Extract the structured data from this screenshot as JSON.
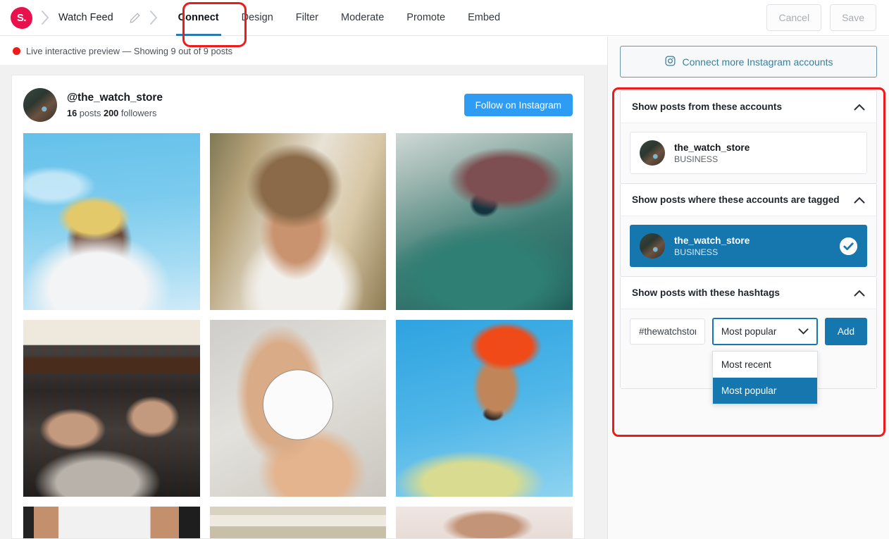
{
  "topbar": {
    "logo_text": "S.",
    "breadcrumb": "Watch Feed",
    "pencil_icon": "pencil-icon",
    "tabs": [
      {
        "label": "Connect",
        "active": true
      },
      {
        "label": "Design",
        "active": false
      },
      {
        "label": "Filter",
        "active": false
      },
      {
        "label": "Moderate",
        "active": false
      },
      {
        "label": "Promote",
        "active": false
      },
      {
        "label": "Embed",
        "active": false
      }
    ],
    "cancel_label": "Cancel",
    "save_label": "Save"
  },
  "status": {
    "text": "Live interactive preview — Showing 9 out of 9 posts",
    "dot_color": "#ee1b1b"
  },
  "preview": {
    "handle": "@the_watch_store",
    "posts_count": "16",
    "posts_word": "posts",
    "followers_count": "200",
    "followers_word": "followers",
    "follow_button": "Follow on Instagram"
  },
  "sidebar": {
    "connect_more_label": "Connect more Instagram accounts",
    "connect_more_icon": "instagram-icon",
    "panels": [
      {
        "title": "Show posts from these accounts",
        "caret": "chevron-up-icon",
        "account": {
          "name": "the_watch_store",
          "type": "BUSINESS",
          "selected": false
        }
      },
      {
        "title": "Show posts where these accounts are tagged",
        "caret": "chevron-up-icon",
        "account": {
          "name": "the_watch_store",
          "type": "BUSINESS",
          "selected": true,
          "check_icon": "check-circle-icon"
        }
      },
      {
        "title": "Show posts with these hashtags",
        "caret": "chevron-up-icon"
      }
    ],
    "hashtag": {
      "input_value": "#thewatchstore",
      "select_value": "Most popular",
      "select_caret": "chevron-down-icon",
      "options": [
        {
          "label": "Most recent",
          "selected": false
        },
        {
          "label": "Most popular",
          "selected": true
        }
      ],
      "add_label": "Add"
    }
  },
  "colors": {
    "brand_pink": "#e8114b",
    "accent_blue": "#1577ad",
    "tab_underline": "#2b7bb0",
    "instagram_blue": "#2f9cf3",
    "annotation_red": "#ee1b1b"
  }
}
